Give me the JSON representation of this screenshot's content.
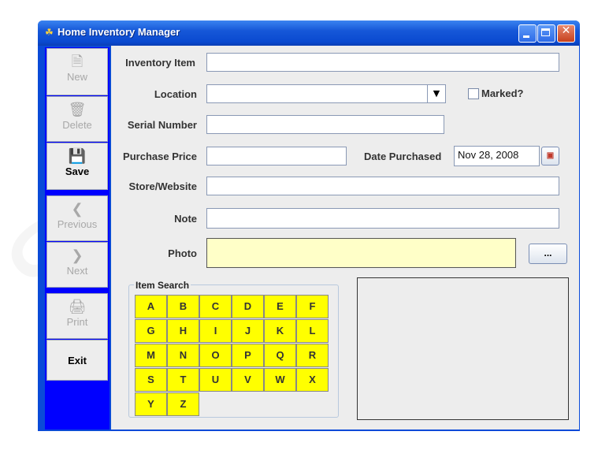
{
  "window": {
    "title": "Home Inventory Manager"
  },
  "toolbar": {
    "new_label": "New",
    "delete_label": "Delete",
    "save_label": "Save",
    "previous_label": "Previous",
    "next_label": "Next",
    "print_label": "Print",
    "exit_label": "Exit"
  },
  "form": {
    "inventory_item_label": "Inventory Item",
    "location_label": "Location",
    "marked_label": "Marked?",
    "serial_label": "Serial Number",
    "price_label": "Purchase Price",
    "date_label": "Date Purchased",
    "date_value": "Nov 28, 2008",
    "store_label": "Store/Website",
    "note_label": "Note",
    "photo_label": "Photo",
    "browse_label": "..."
  },
  "search": {
    "title": "Item Search",
    "keys": [
      "A",
      "B",
      "C",
      "D",
      "E",
      "F",
      "G",
      "H",
      "I",
      "J",
      "K",
      "L",
      "M",
      "N",
      "O",
      "P",
      "Q",
      "R",
      "S",
      "T",
      "U",
      "V",
      "W",
      "X",
      "Y",
      "Z"
    ]
  },
  "colors": {
    "toolbar_bg": "#0000ff",
    "photo_bg": "#ffffc8",
    "key_bg": "#ffff00"
  }
}
